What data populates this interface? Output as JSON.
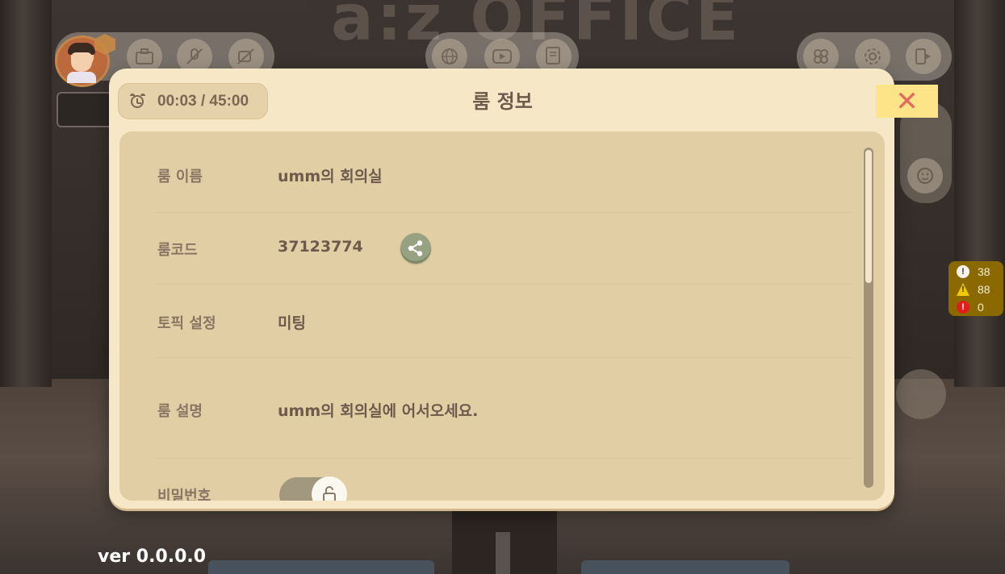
{
  "background": {
    "sign_text": "a:z OFFICE"
  },
  "hud": {
    "top_left_icons": [
      "briefcase-icon",
      "no-mic-icon",
      "no-video-icon"
    ],
    "top_center_icons": [
      "globe-icon",
      "video-play-icon",
      "document-share-icon"
    ],
    "top_right_icons": [
      "flower-icon",
      "gear-icon",
      "exit-icon"
    ]
  },
  "counters": {
    "info": "38",
    "warning": "88",
    "error": "0"
  },
  "version": "ver 0.0.0.0",
  "modal": {
    "title": "룸 정보",
    "timer": "00:03 / 45:00",
    "close_symbol": "✕",
    "rows": [
      {
        "label": "룸 이름",
        "value": "umm의 회의실"
      },
      {
        "label": "룸코드",
        "value": "37123774"
      },
      {
        "label": "토픽 설정",
        "value": "미팅"
      },
      {
        "label": "룸 설명",
        "value": "umm의 회의실에 어서오세요."
      },
      {
        "label": "비밀번호",
        "value": ""
      }
    ],
    "password_toggle": {
      "enabled": true
    },
    "scrollbar": {
      "position_fraction": 0.0
    }
  },
  "colors": {
    "modal_bg": "#f6e8c7",
    "content_bg": "#e2cea5",
    "close_bg": "#fee488",
    "close_x": "#e16c5e",
    "title": "#6f5a4b",
    "counter_bg": "#8a6a00"
  }
}
